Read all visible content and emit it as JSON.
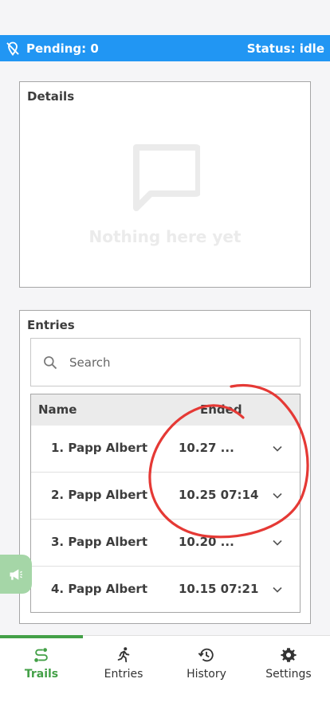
{
  "status_bar": {
    "pending": "Pending: 0",
    "status": "Status: idle",
    "colors": {
      "background": "#2196f3",
      "text": "#ffffff"
    },
    "icon": "location-off-icon"
  },
  "details": {
    "title": "Details",
    "empty_text": "Nothing here yet",
    "empty_icon": "chat-bubble-icon"
  },
  "entries": {
    "title": "Entries",
    "search": {
      "placeholder": "Search",
      "value": ""
    },
    "columns": {
      "name": "Name",
      "ended": "Ended"
    },
    "rows": [
      {
        "name": "1. Papp Albert",
        "ended": "10.27 ..."
      },
      {
        "name": "2. Papp Albert",
        "ended": "10.25 07:14"
      },
      {
        "name": "3. Papp Albert",
        "ended": "10.20 ..."
      },
      {
        "name": "4. Papp Albert",
        "ended": "10.15 07:21"
      }
    ]
  },
  "feedback_button": {
    "icon": "megaphone-icon",
    "color": "#a5d6a7"
  },
  "bottom_nav": {
    "active_color": "#43a047",
    "tabs": [
      {
        "label": "Trails",
        "icon": "route-icon",
        "active": true
      },
      {
        "label": "Entries",
        "icon": "running-icon",
        "active": false
      },
      {
        "label": "History",
        "icon": "history-icon",
        "active": false
      },
      {
        "label": "Settings",
        "icon": "gear-icon",
        "active": false
      }
    ]
  },
  "annotation": {
    "type": "hand-drawn-circle",
    "color": "#e53935"
  }
}
